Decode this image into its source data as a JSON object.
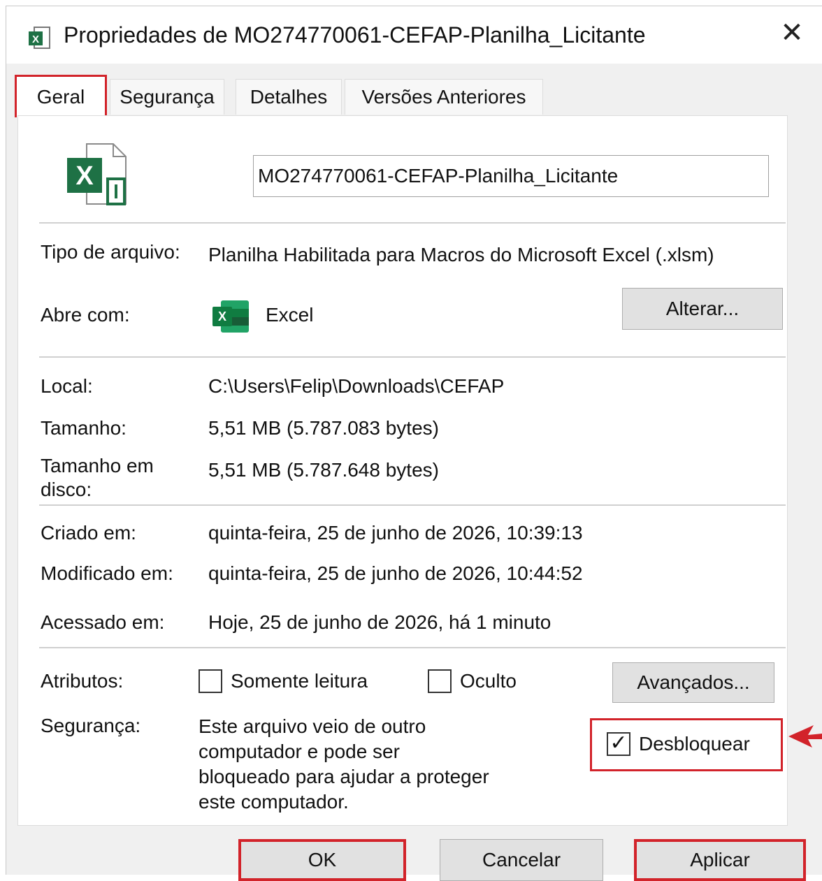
{
  "window": {
    "title": "Propriedades de MO274770061-CEFAP-Planilha_Licitante",
    "close_glyph": "✕"
  },
  "tabs": [
    {
      "label": "Geral",
      "active": true
    },
    {
      "label": "Segurança",
      "active": false
    },
    {
      "label": "Detalhes",
      "active": false
    },
    {
      "label": "Versões Anteriores",
      "active": false
    }
  ],
  "file": {
    "name": "MO274770061-CEFAP-Planilha_Licitante",
    "icon": "excel-file-icon"
  },
  "type_section": {
    "type_label": "Tipo de arquivo:",
    "type_value": "Planilha Habilitada para Macros do Microsoft Excel (.xlsm)",
    "opens_label": "Abre com:",
    "opens_value": "Excel",
    "change_button": "Alterar..."
  },
  "location_section": {
    "location_label": "Local:",
    "location_value": "C:\\Users\\Felip\\Downloads\\CEFAP",
    "size_label": "Tamanho:",
    "size_value": "5,51 MB (5.787.083 bytes)",
    "disk_size_label": "Tamanho em disco:",
    "disk_size_value": "5,51 MB (5.787.648 bytes)"
  },
  "dates_section": {
    "created_label": "Criado em:",
    "created_value": "quinta-feira, 25 de junho de 2026, 10:39:13",
    "modified_label": "Modificado em:",
    "modified_value": "quinta-feira, 25 de junho de 2026, 10:44:52",
    "accessed_label": "Acessado em:",
    "accessed_value": "Hoje, 25 de junho de 2026, há 1 minuto"
  },
  "attributes_section": {
    "label": "Atributos:",
    "readonly_label": "Somente leitura",
    "readonly_checked": false,
    "hidden_label": "Oculto",
    "hidden_checked": false,
    "advanced_button": "Avançados..."
  },
  "security_section": {
    "label": "Segurança:",
    "message": "Este arquivo veio de outro computador e pode ser bloqueado para ajudar a proteger este computador.",
    "unblock_label": "Desbloquear",
    "unblock_checked": true,
    "check_glyph": "✓"
  },
  "footer": {
    "ok": "OK",
    "cancel": "Cancelar",
    "apply": "Aplicar"
  },
  "colors": {
    "highlight_red": "#d2232a",
    "excel_green": "#1e7145"
  }
}
